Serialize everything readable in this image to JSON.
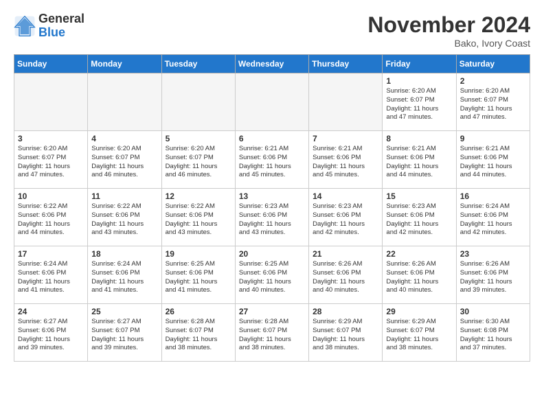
{
  "logo": {
    "general": "General",
    "blue": "Blue"
  },
  "title": "November 2024",
  "subtitle": "Bako, Ivory Coast",
  "weekdays": [
    "Sunday",
    "Monday",
    "Tuesday",
    "Wednesday",
    "Thursday",
    "Friday",
    "Saturday"
  ],
  "weeks": [
    [
      {
        "day": "",
        "info": ""
      },
      {
        "day": "",
        "info": ""
      },
      {
        "day": "",
        "info": ""
      },
      {
        "day": "",
        "info": ""
      },
      {
        "day": "",
        "info": ""
      },
      {
        "day": "1",
        "info": "Sunrise: 6:20 AM\nSunset: 6:07 PM\nDaylight: 11 hours\nand 47 minutes."
      },
      {
        "day": "2",
        "info": "Sunrise: 6:20 AM\nSunset: 6:07 PM\nDaylight: 11 hours\nand 47 minutes."
      }
    ],
    [
      {
        "day": "3",
        "info": "Sunrise: 6:20 AM\nSunset: 6:07 PM\nDaylight: 11 hours\nand 47 minutes."
      },
      {
        "day": "4",
        "info": "Sunrise: 6:20 AM\nSunset: 6:07 PM\nDaylight: 11 hours\nand 46 minutes."
      },
      {
        "day": "5",
        "info": "Sunrise: 6:20 AM\nSunset: 6:07 PM\nDaylight: 11 hours\nand 46 minutes."
      },
      {
        "day": "6",
        "info": "Sunrise: 6:21 AM\nSunset: 6:06 PM\nDaylight: 11 hours\nand 45 minutes."
      },
      {
        "day": "7",
        "info": "Sunrise: 6:21 AM\nSunset: 6:06 PM\nDaylight: 11 hours\nand 45 minutes."
      },
      {
        "day": "8",
        "info": "Sunrise: 6:21 AM\nSunset: 6:06 PM\nDaylight: 11 hours\nand 44 minutes."
      },
      {
        "day": "9",
        "info": "Sunrise: 6:21 AM\nSunset: 6:06 PM\nDaylight: 11 hours\nand 44 minutes."
      }
    ],
    [
      {
        "day": "10",
        "info": "Sunrise: 6:22 AM\nSunset: 6:06 PM\nDaylight: 11 hours\nand 44 minutes."
      },
      {
        "day": "11",
        "info": "Sunrise: 6:22 AM\nSunset: 6:06 PM\nDaylight: 11 hours\nand 43 minutes."
      },
      {
        "day": "12",
        "info": "Sunrise: 6:22 AM\nSunset: 6:06 PM\nDaylight: 11 hours\nand 43 minutes."
      },
      {
        "day": "13",
        "info": "Sunrise: 6:23 AM\nSunset: 6:06 PM\nDaylight: 11 hours\nand 43 minutes."
      },
      {
        "day": "14",
        "info": "Sunrise: 6:23 AM\nSunset: 6:06 PM\nDaylight: 11 hours\nand 42 minutes."
      },
      {
        "day": "15",
        "info": "Sunrise: 6:23 AM\nSunset: 6:06 PM\nDaylight: 11 hours\nand 42 minutes."
      },
      {
        "day": "16",
        "info": "Sunrise: 6:24 AM\nSunset: 6:06 PM\nDaylight: 11 hours\nand 42 minutes."
      }
    ],
    [
      {
        "day": "17",
        "info": "Sunrise: 6:24 AM\nSunset: 6:06 PM\nDaylight: 11 hours\nand 41 minutes."
      },
      {
        "day": "18",
        "info": "Sunrise: 6:24 AM\nSunset: 6:06 PM\nDaylight: 11 hours\nand 41 minutes."
      },
      {
        "day": "19",
        "info": "Sunrise: 6:25 AM\nSunset: 6:06 PM\nDaylight: 11 hours\nand 41 minutes."
      },
      {
        "day": "20",
        "info": "Sunrise: 6:25 AM\nSunset: 6:06 PM\nDaylight: 11 hours\nand 40 minutes."
      },
      {
        "day": "21",
        "info": "Sunrise: 6:26 AM\nSunset: 6:06 PM\nDaylight: 11 hours\nand 40 minutes."
      },
      {
        "day": "22",
        "info": "Sunrise: 6:26 AM\nSunset: 6:06 PM\nDaylight: 11 hours\nand 40 minutes."
      },
      {
        "day": "23",
        "info": "Sunrise: 6:26 AM\nSunset: 6:06 PM\nDaylight: 11 hours\nand 39 minutes."
      }
    ],
    [
      {
        "day": "24",
        "info": "Sunrise: 6:27 AM\nSunset: 6:06 PM\nDaylight: 11 hours\nand 39 minutes."
      },
      {
        "day": "25",
        "info": "Sunrise: 6:27 AM\nSunset: 6:07 PM\nDaylight: 11 hours\nand 39 minutes."
      },
      {
        "day": "26",
        "info": "Sunrise: 6:28 AM\nSunset: 6:07 PM\nDaylight: 11 hours\nand 38 minutes."
      },
      {
        "day": "27",
        "info": "Sunrise: 6:28 AM\nSunset: 6:07 PM\nDaylight: 11 hours\nand 38 minutes."
      },
      {
        "day": "28",
        "info": "Sunrise: 6:29 AM\nSunset: 6:07 PM\nDaylight: 11 hours\nand 38 minutes."
      },
      {
        "day": "29",
        "info": "Sunrise: 6:29 AM\nSunset: 6:07 PM\nDaylight: 11 hours\nand 38 minutes."
      },
      {
        "day": "30",
        "info": "Sunrise: 6:30 AM\nSunset: 6:08 PM\nDaylight: 11 hours\nand 37 minutes."
      }
    ]
  ]
}
